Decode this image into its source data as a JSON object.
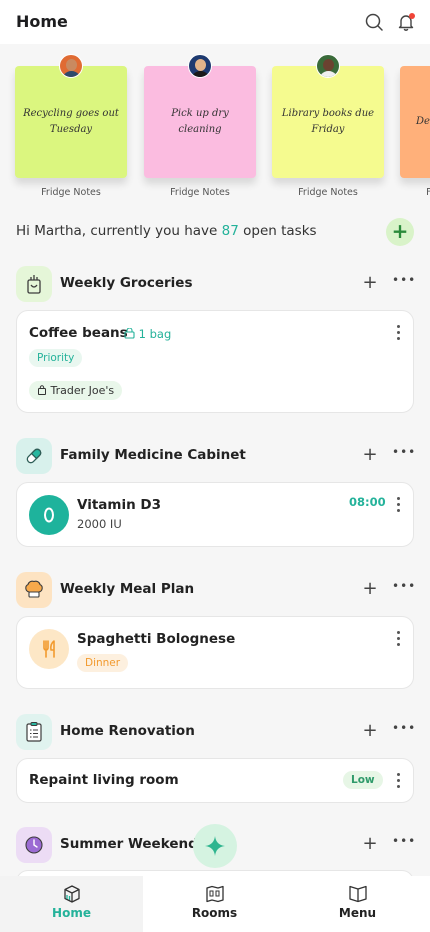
{
  "header": {
    "title": "Home"
  },
  "notes": [
    {
      "text": "Recycling goes out Tuesday",
      "caption": "Fridge Notes",
      "color": "#dbf67f",
      "avatar_skin": "#c98a60",
      "avatar_bg": "#e06b33",
      "avatar_cloth": "#2e4a6b"
    },
    {
      "text": "Pick up dry cleaning",
      "caption": "Fridge Notes",
      "color": "#fbbce0",
      "avatar_skin": "#e2b48a",
      "avatar_bg": "#1e3a70",
      "avatar_cloth": "#1a1a1a"
    },
    {
      "text": "Library books due Friday",
      "caption": "Fridge Notes",
      "color": "#f5fb8f",
      "avatar_skin": "#6b4230",
      "avatar_bg": "#3a6b3a",
      "avatar_cloth": "#f0f0f0"
    },
    {
      "text": "Dentist me...",
      "caption": "Fridge Notes",
      "color": "#ffb07a",
      "avatar_skin": "#e2b48a",
      "avatar_bg": "#888888",
      "avatar_cloth": "#444444"
    }
  ],
  "greeting": {
    "prefix": "Hi Martha, currently you have",
    "count": "87",
    "suffix": "open tasks"
  },
  "sections": {
    "groceries": {
      "title": "Weekly Groceries",
      "item": {
        "name": "Coffee beans",
        "qty": "1 bag",
        "priority": "Priority",
        "store": "Trader Joe's"
      }
    },
    "medicine": {
      "title": "Family Medicine Cabinet",
      "item": {
        "name": "Vitamin D3",
        "dose": "2000 IU",
        "time": "08:00"
      }
    },
    "meal": {
      "title": "Weekly Meal Plan",
      "item": {
        "name": "Spaghetti Bolognese",
        "tag": "Dinner"
      }
    },
    "renovation": {
      "title": "Home Renovation",
      "item": {
        "name": "Repaint living room",
        "priority": "Low"
      }
    },
    "summer": {
      "title": "Summer Weekends"
    }
  },
  "tabs": [
    {
      "label": "Home",
      "active": true
    },
    {
      "label": "Rooms",
      "active": false
    },
    {
      "label": "Menu",
      "active": false
    }
  ],
  "colors": {
    "accent": "#24b29a",
    "orange": "#f29a2e"
  }
}
